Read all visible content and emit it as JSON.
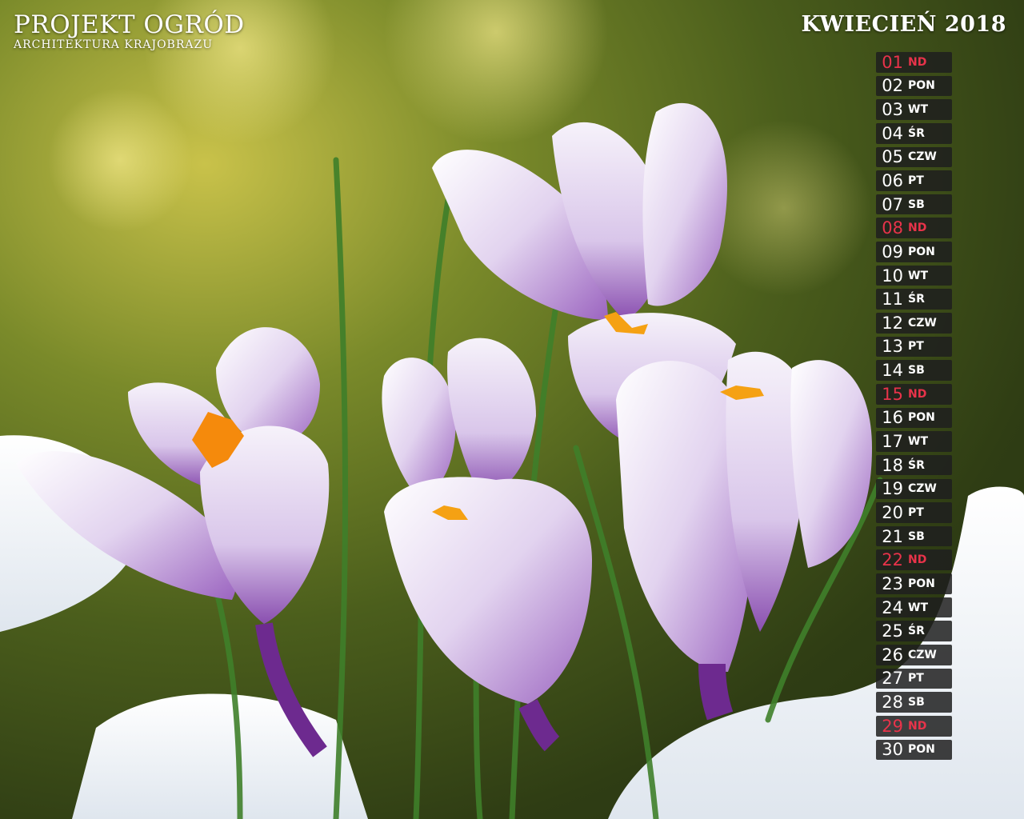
{
  "brand": {
    "title": "PROJEKT OGRÓD",
    "subtitle": "ARCHITEKTURA  KRAJOBRAZU"
  },
  "calendar": {
    "month_label": "KWIECIEŃ 2018",
    "days": [
      {
        "num": "01",
        "name": "ND",
        "sunday": true
      },
      {
        "num": "02",
        "name": "PON",
        "sunday": false
      },
      {
        "num": "03",
        "name": "WT",
        "sunday": false
      },
      {
        "num": "04",
        "name": "ŚR",
        "sunday": false
      },
      {
        "num": "05",
        "name": "CZW",
        "sunday": false
      },
      {
        "num": "06",
        "name": "PT",
        "sunday": false
      },
      {
        "num": "07",
        "name": "SB",
        "sunday": false
      },
      {
        "num": "08",
        "name": "ND",
        "sunday": true
      },
      {
        "num": "09",
        "name": "PON",
        "sunday": false
      },
      {
        "num": "10",
        "name": "WT",
        "sunday": false
      },
      {
        "num": "11",
        "name": "ŚR",
        "sunday": false
      },
      {
        "num": "12",
        "name": "CZW",
        "sunday": false
      },
      {
        "num": "13",
        "name": "PT",
        "sunday": false
      },
      {
        "num": "14",
        "name": "SB",
        "sunday": false
      },
      {
        "num": "15",
        "name": "ND",
        "sunday": true
      },
      {
        "num": "16",
        "name": "PON",
        "sunday": false
      },
      {
        "num": "17",
        "name": "WT",
        "sunday": false
      },
      {
        "num": "18",
        "name": "ŚR",
        "sunday": false
      },
      {
        "num": "19",
        "name": "CZW",
        "sunday": false
      },
      {
        "num": "20",
        "name": "PT",
        "sunday": false
      },
      {
        "num": "21",
        "name": "SB",
        "sunday": false
      },
      {
        "num": "22",
        "name": "ND",
        "sunday": true
      },
      {
        "num": "23",
        "name": "PON",
        "sunday": false
      },
      {
        "num": "24",
        "name": "WT",
        "sunday": false
      },
      {
        "num": "25",
        "name": "ŚR",
        "sunday": false
      },
      {
        "num": "26",
        "name": "CZW",
        "sunday": false
      },
      {
        "num": "27",
        "name": "PT",
        "sunday": false
      },
      {
        "num": "28",
        "name": "SB",
        "sunday": false
      },
      {
        "num": "29",
        "name": "ND",
        "sunday": true
      },
      {
        "num": "30",
        "name": "PON",
        "sunday": false
      }
    ]
  },
  "colors": {
    "sunday": "#e8334a",
    "weekday": "#ffffff",
    "day_bg": "#1e1e1e"
  },
  "background": {
    "subject": "crocus-flowers-in-snow"
  }
}
